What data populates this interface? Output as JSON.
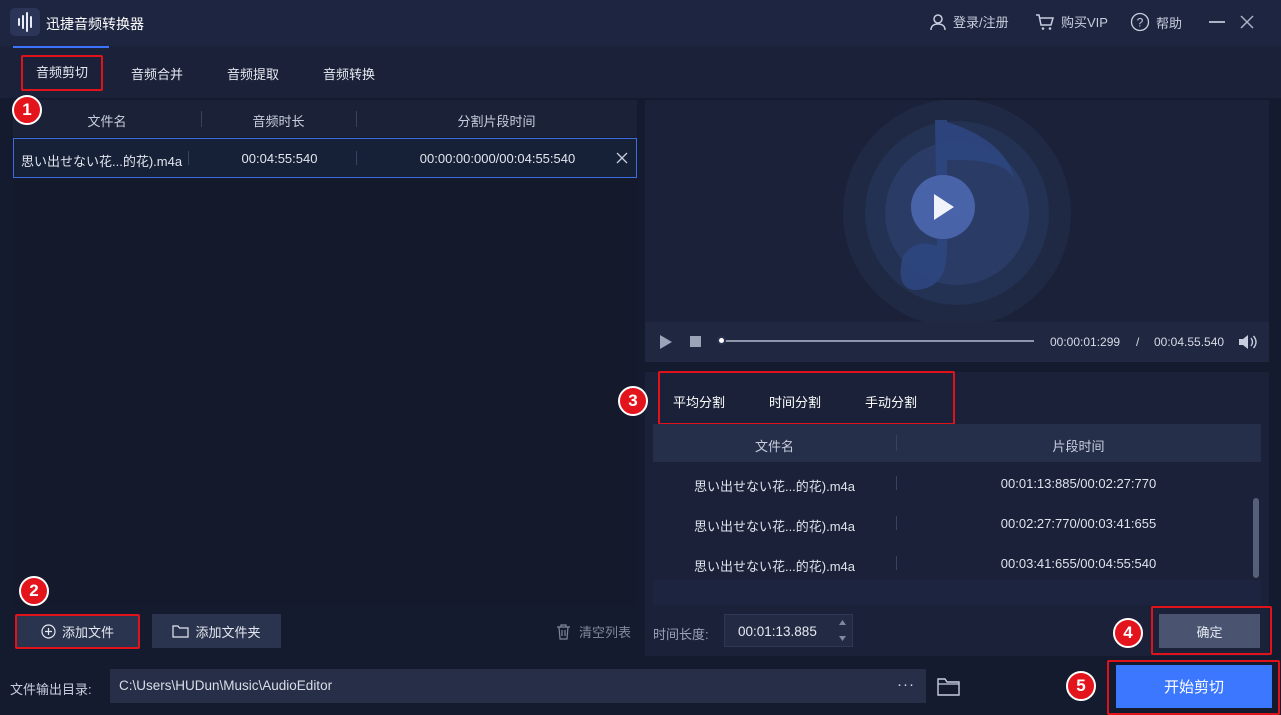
{
  "app": {
    "title": "迅捷音频转换器"
  },
  "titlebar": {
    "login": "登录/注册",
    "vip": "购买VIP",
    "help": "帮助"
  },
  "tabs": [
    {
      "label": "音频剪切"
    },
    {
      "label": "音频合并"
    },
    {
      "label": "音频提取"
    },
    {
      "label": "音频转换"
    }
  ],
  "file_table": {
    "headers": [
      "文件名",
      "音频时长",
      "分割片段时间"
    ],
    "rows": [
      {
        "name": "思い出せない花...的花).m4a",
        "duration": "00:04:55:540",
        "segment": "00:00:00:000/00:04:55:540"
      }
    ]
  },
  "left_buttons": {
    "add_file": "添加文件",
    "add_folder": "添加文件夹",
    "clear": "清空列表"
  },
  "player": {
    "current": "00:00:01:299",
    "separator": "/",
    "total": "00:04.55.540",
    "progress": 0.0
  },
  "split_tabs": [
    "平均分割",
    "时间分割",
    "手动分割"
  ],
  "segment_table": {
    "headers": [
      "文件名",
      "片段时间"
    ],
    "rows": [
      {
        "name": "思い出せない花...的花).m4a",
        "time": "00:01:13:885/00:02:27:770"
      },
      {
        "name": "思い出せない花...的花).m4a",
        "time": "00:02:27:770/00:03:41:655"
      },
      {
        "name": "思い出せない花...的花).m4a",
        "time": "00:03:41:655/00:04:55:540"
      }
    ]
  },
  "duration_field": {
    "label": "时间长度:",
    "value": "00:01:13.885"
  },
  "confirm": "确定",
  "output": {
    "label": "文件输出目录:",
    "path": "C:\\Users\\HUDun\\Music\\AudioEditor",
    "more": "···"
  },
  "start": "开始剪切",
  "badges": [
    "1",
    "2",
    "3",
    "4",
    "5"
  ],
  "colors": {
    "accent": "#3b77ff",
    "highlight": "#e3141c",
    "background": "#151b2e"
  }
}
